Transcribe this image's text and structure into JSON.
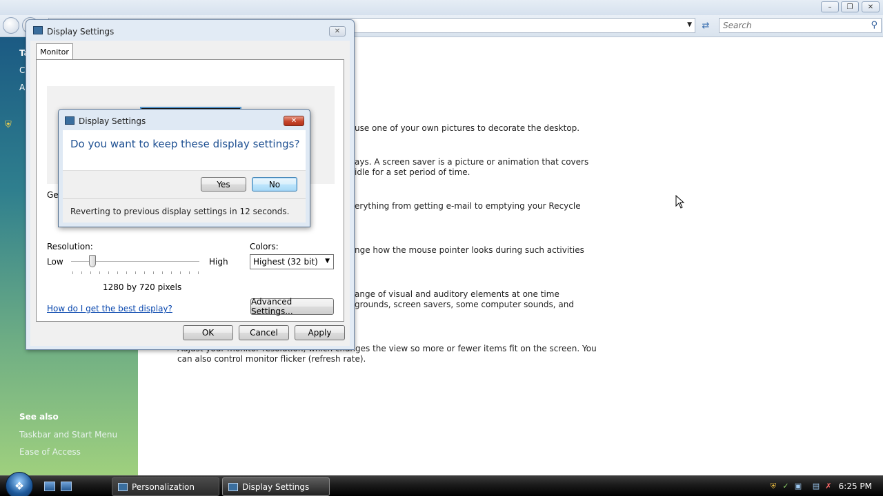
{
  "background_window": {
    "search_placeholder": "Search",
    "sidebar_fragments": [
      "Ta",
      "C",
      "A"
    ],
    "see_also": "See also",
    "see_also_links": [
      "Taskbar and Start Menu",
      "Ease of Access"
    ],
    "descriptions": [
      "use one of your own pictures to decorate the desktop.",
      "ays. A screen saver is a picture or animation that covers",
      "idle for a set period of time.",
      "erything from getting e-mail to emptying your Recycle",
      "nge how the mouse pointer looks during such activities",
      "ange of visual and auditory elements at one time",
      "grounds, screen savers, some computer sounds, and",
      "Adjust your monitor resolution, which changes the view so more or fewer items fit on the screen. You",
      "can also control monitor flicker (refresh rate)."
    ]
  },
  "display_dialog": {
    "title": "Display Settings",
    "tab": "Monitor",
    "fragment": "Gen",
    "resolution_label": "Resolution:",
    "low": "Low",
    "high": "High",
    "resolution_value": "1280 by 720 pixels",
    "colors_label": "Colors:",
    "colors_value": "Highest (32 bit)",
    "help_link": "How do I get the best display?",
    "advanced_button": "Advanced Settings...",
    "ok": "OK",
    "cancel": "Cancel",
    "apply": "Apply"
  },
  "confirm_dialog": {
    "title": "Display Settings",
    "question": "Do you want to keep these display settings?",
    "yes": "Yes",
    "no": "No",
    "status": "Reverting to previous display settings in 12 seconds."
  },
  "taskbar": {
    "tasks": [
      "Personalization",
      "Display Settings"
    ],
    "clock": "6:25 PM"
  }
}
